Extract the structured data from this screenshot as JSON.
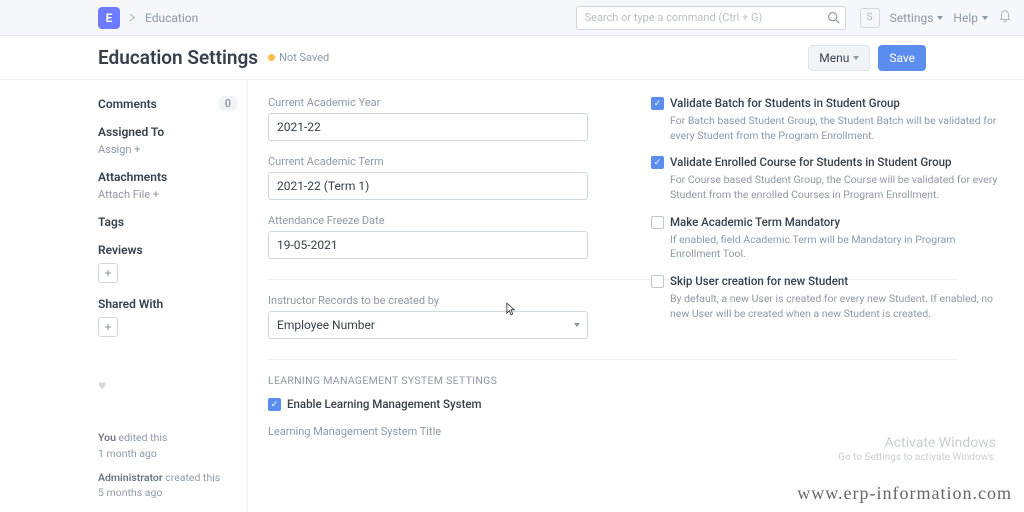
{
  "topbar": {
    "logo_letter": "E",
    "breadcrumb": "Education",
    "search_placeholder": "Search or type a command (Ctrl + G)",
    "user_letter": "S",
    "settings_label": "Settings",
    "help_label": "Help"
  },
  "header": {
    "title": "Education Settings",
    "status": "Not Saved",
    "menu_label": "Menu",
    "save_label": "Save"
  },
  "sidebar": {
    "comments_label": "Comments",
    "comments_count": "0",
    "assigned_label": "Assigned To",
    "assign_action": "Assign +",
    "attachments_label": "Attachments",
    "attach_action": "Attach File +",
    "tags_label": "Tags",
    "reviews_label": "Reviews",
    "shared_label": "Shared With",
    "meta1_a": "You",
    "meta1_b": " edited this",
    "meta1_c": "1 month ago",
    "meta2_a": "Administrator",
    "meta2_b": " created this",
    "meta2_c": "5 months ago"
  },
  "form": {
    "left": {
      "acad_year_label": "Current Academic Year",
      "acad_year_value": "2021-22",
      "acad_term_label": "Current Academic Term",
      "acad_term_value": "2021-22 (Term 1)",
      "freeze_label": "Attendance Freeze Date",
      "freeze_value": "19-05-2021",
      "instructor_label": "Instructor Records to be created by",
      "instructor_value": "Employee Number"
    },
    "right": {
      "cb1_label": "Validate Batch for Students in Student Group",
      "cb1_help": "For Batch based Student Group, the Student Batch will be validated for every Student from the Program Enrollment.",
      "cb2_label": "Validate Enrolled Course for Students in Student Group",
      "cb2_help": "For Course based Student Group, the Course will be validated for every Student from the enrolled Courses in Program Enrollment.",
      "cb3_label": "Make Academic Term Mandatory",
      "cb3_help": "If enabled, field Academic Term will be Mandatory in Program Enrollment Tool.",
      "cb4_label": "Skip User creation for new Student",
      "cb4_help": "By default, a new User is created for every new Student. If enabled, no new User will be created when a new Student is created."
    },
    "lms": {
      "section_title": "LEARNING MANAGEMENT SYSTEM SETTINGS",
      "enable_label": "Enable Learning Management System",
      "title_label": "Learning Management System Title"
    }
  },
  "watermark": {
    "title": "Activate Windows",
    "sub": "Go to Settings to activate Windows."
  },
  "url": "www.erp-information.com"
}
